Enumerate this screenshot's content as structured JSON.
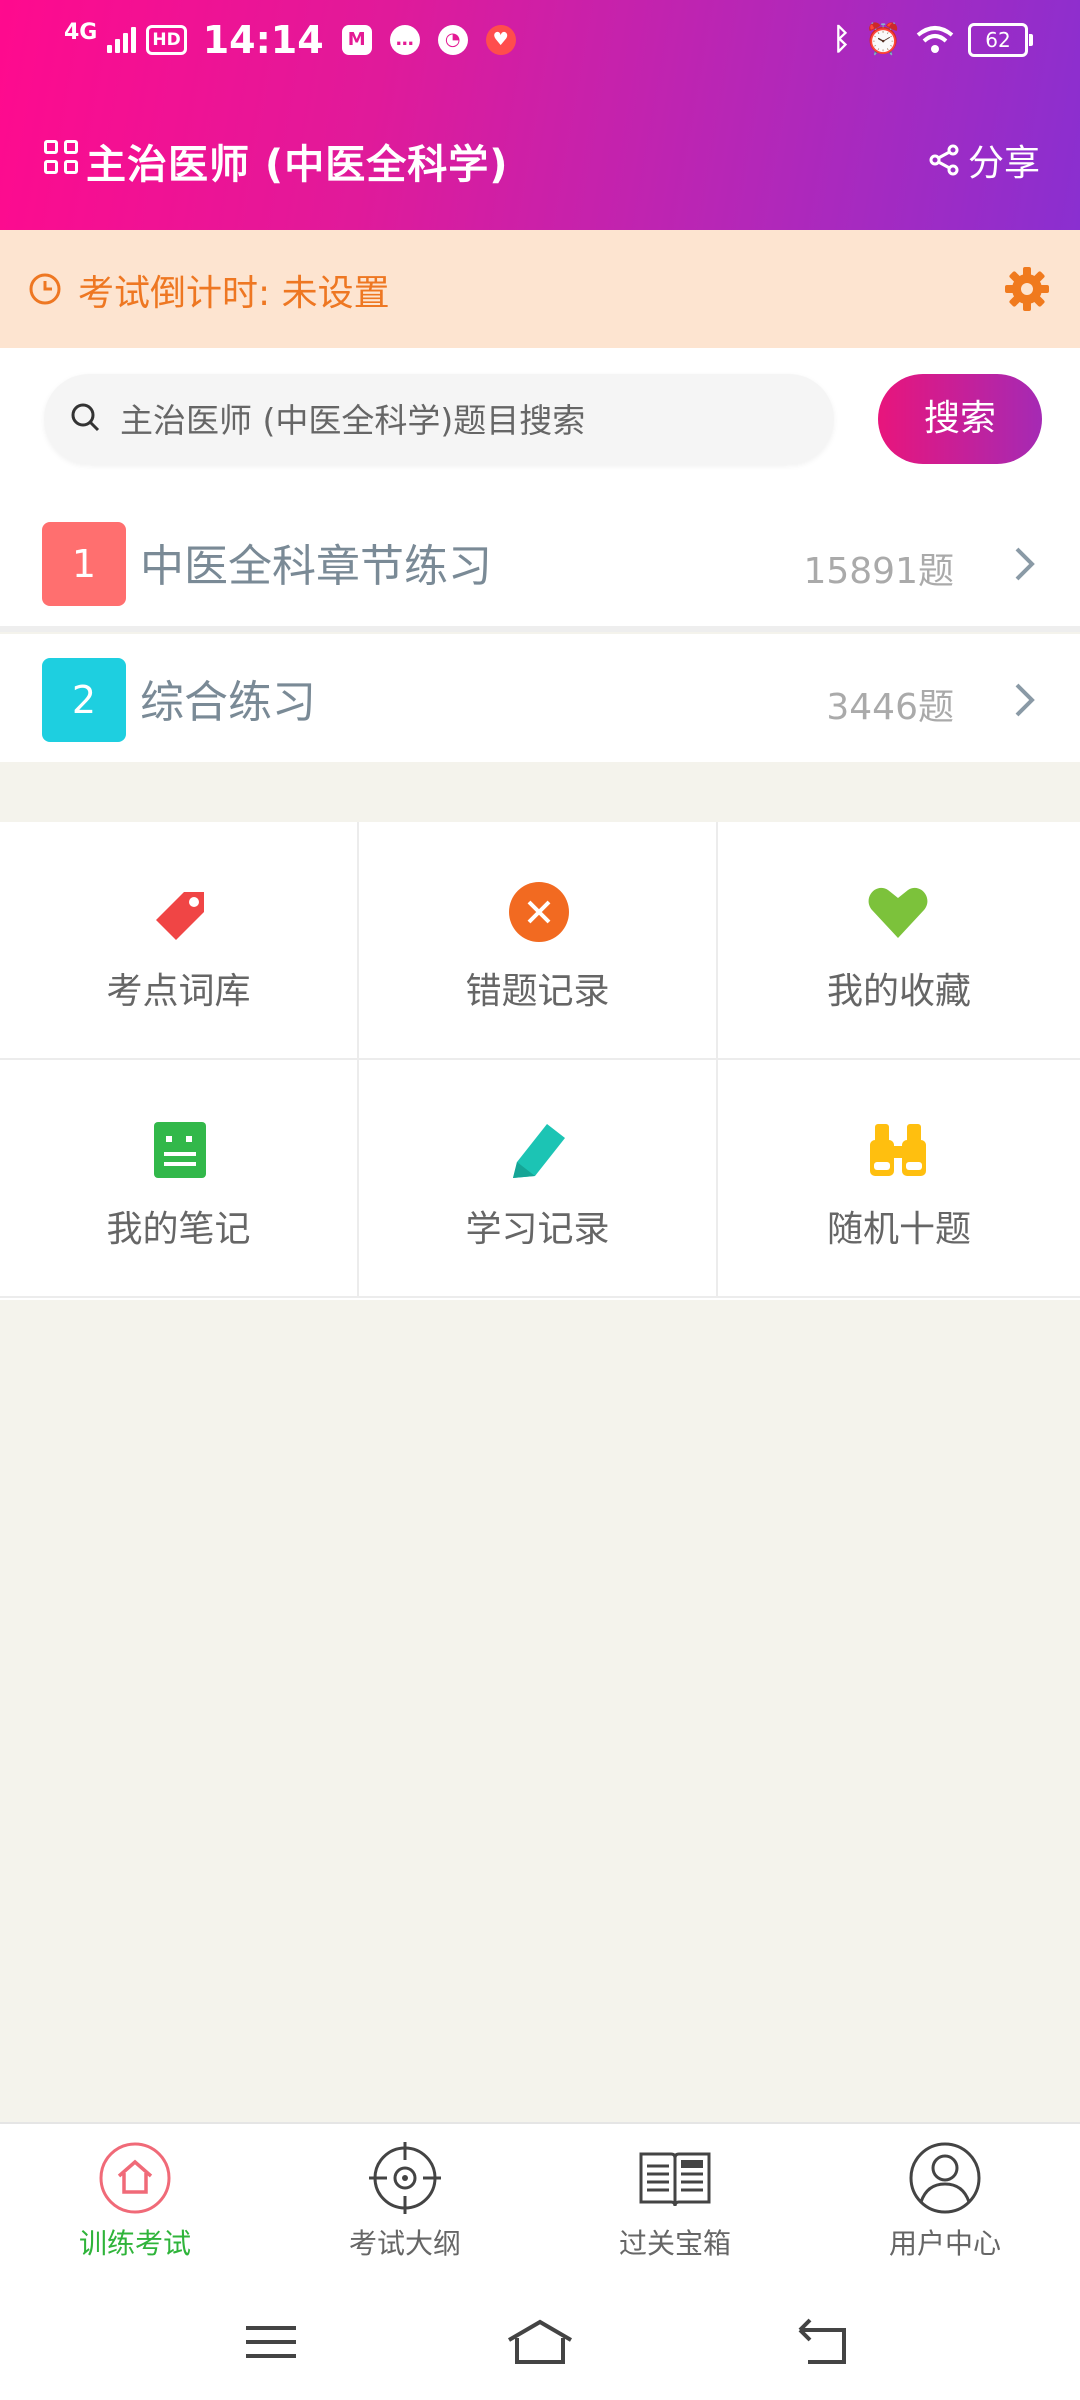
{
  "status_bar": {
    "network": "4G",
    "hd": "HD",
    "time": "14:14",
    "battery": "62"
  },
  "header": {
    "title": "主治医师 (中医全科学)",
    "share_label": "分享"
  },
  "countdown": {
    "text": "考试倒计时: 未设置"
  },
  "search": {
    "placeholder": "主治医师 (中医全科学)题目搜索",
    "button_label": "搜索"
  },
  "list": [
    {
      "index": "1",
      "label": "中医全科章节练习",
      "count": "15891题",
      "color": "#ff6f6f"
    },
    {
      "index": "2",
      "label": "综合练习",
      "count": "3446题",
      "color": "#1ecfe0"
    }
  ],
  "grid": [
    {
      "label": "考点词库",
      "icon": "tag-icon",
      "color": "#f04545"
    },
    {
      "label": "错题记录",
      "icon": "close-circle-icon",
      "color": "#f26a21"
    },
    {
      "label": "我的收藏",
      "icon": "heart-icon",
      "color": "#7cc23b"
    },
    {
      "label": "我的笔记",
      "icon": "note-icon",
      "color": "#32b84a"
    },
    {
      "label": "学习记录",
      "icon": "pencil-icon",
      "color": "#1cc4b4"
    },
    {
      "label": "随机十题",
      "icon": "binoculars-icon",
      "color": "#ffbf0f"
    }
  ],
  "bottom_nav": [
    {
      "label": "训练考试",
      "icon": "home-icon",
      "active": true
    },
    {
      "label": "考试大纲",
      "icon": "target-icon",
      "active": false
    },
    {
      "label": "过关宝箱",
      "icon": "news-book-icon",
      "active": false
    },
    {
      "label": "用户中心",
      "icon": "user-icon",
      "active": false
    }
  ],
  "colors": {
    "accent": "#e8157c",
    "header_gradient_start": "#ff0a8e",
    "header_gradient_end": "#8a2fd0",
    "countdown_text": "#ee7722",
    "active_nav": "#2fb43a"
  }
}
